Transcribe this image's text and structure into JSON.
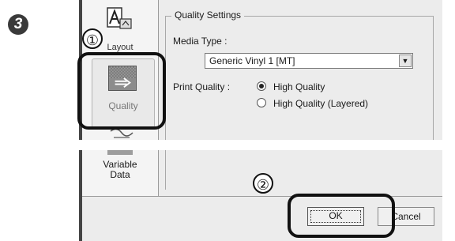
{
  "step": {
    "number": "3"
  },
  "callouts": {
    "one": "①",
    "two": "②"
  },
  "sidebar": {
    "layout_label": "Layout",
    "quality_label": "Quality",
    "variable_data_label_line1": "Variable",
    "variable_data_label_line2": "Data"
  },
  "quality_settings": {
    "group_title": "Quality Settings",
    "media_type_label": "Media Type :",
    "media_type_value": "Generic Vinyl 1 [MT]",
    "print_quality_label": "Print Quality :",
    "options": [
      {
        "label": "High Quality",
        "selected": true
      },
      {
        "label": "High Quality (Layered)",
        "selected": false
      }
    ]
  },
  "buttons": {
    "ok": "OK",
    "cancel": "Cancel"
  },
  "icons": {
    "layout": "layout-icon",
    "quality": "quality-icon",
    "dropdown": "chevron-down-icon",
    "variable_data": "variable-data-icon"
  }
}
